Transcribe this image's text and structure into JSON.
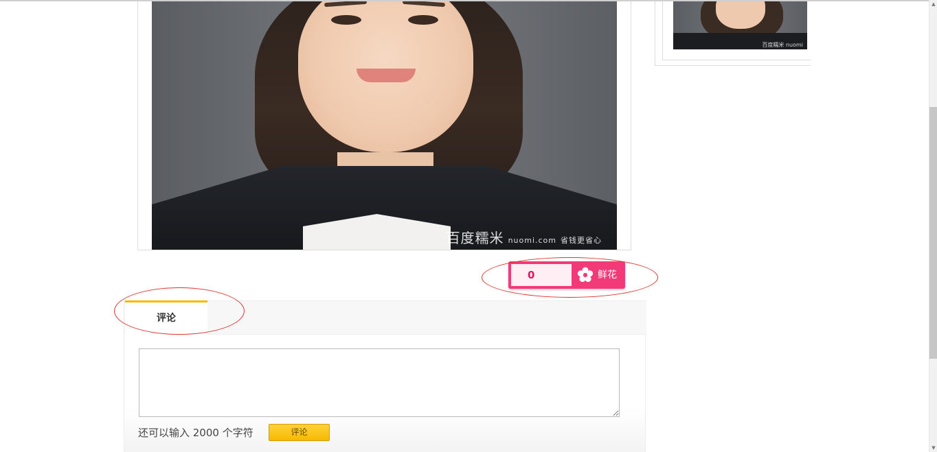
{
  "photo": {
    "watermark_brand": "百度糯米",
    "watermark_site": "nuomi.com",
    "watermark_slogan": "省钱更省心"
  },
  "thumbnail": {
    "watermark": "百度糯米 nuomi"
  },
  "flower": {
    "count": "0",
    "button_label": "鲜花",
    "accent_color": "#f23a78"
  },
  "comments": {
    "tab_label": "评论",
    "textarea_value": "",
    "char_hint": "还可以输入 2000 个字符",
    "submit_label": "评论",
    "tab_accent_color": "#f5b900"
  },
  "annotations": {
    "color": "#e0302a"
  },
  "scrollbar": {
    "up_icon": "arrow-up-icon",
    "down_icon": "arrow-down-icon"
  }
}
